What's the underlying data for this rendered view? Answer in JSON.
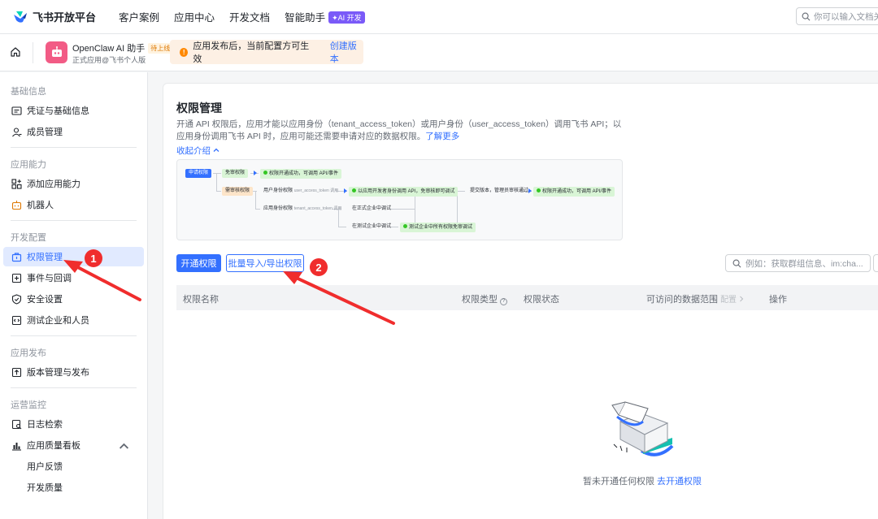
{
  "topnav": {
    "logo_text": "飞书开放平台",
    "links": [
      "客户案例",
      "应用中心",
      "开发文档",
      "智能助手"
    ],
    "ai_badge": "✦AI 开发",
    "search_placeholder": "你可以输入文档关"
  },
  "appbar": {
    "app_name": "OpenClaw AI 助手",
    "pending_badge": "待上线",
    "app_sub": "正式应用@飞书个人版",
    "notice_text": "应用发布后，当前配置方可生效",
    "notice_link": "创建版本"
  },
  "sidebar": {
    "sections": [
      {
        "title": "基础信息",
        "items": [
          "凭证与基础信息",
          "成员管理"
        ]
      },
      {
        "title": "应用能力",
        "items": [
          "添加应用能力",
          "机器人"
        ]
      },
      {
        "title": "开发配置",
        "items": [
          "权限管理",
          "事件与回调",
          "安全设置",
          "测试企业和人员"
        ]
      },
      {
        "title": "应用发布",
        "items": [
          "版本管理与发布"
        ]
      },
      {
        "title": "运营监控",
        "items": [
          "日志检索",
          "应用质量看板",
          "用户反馈",
          "开发质量"
        ]
      }
    ],
    "active_item": "权限管理"
  },
  "main": {
    "title": "权限管理",
    "description": "开通 API 权限后，应用才能以应用身份（tenant_access_token）或用户身份（user_access_token）调用飞书 API；以应用身份调用飞书 API 时，应用可能还需要申请对应的数据权限。",
    "learn_more": "了解更多",
    "collapse_link": "收起介绍",
    "flow": {
      "apply": "申请权限",
      "free_review": "免审权限",
      "enabled_call": "权限开通成功，可调用 API/事件",
      "need_review": "需审核权限",
      "user_perm": "用户身份权限",
      "user_token": "user_access_token 调用",
      "dev_identity": "以应用开发者身份调用 API，免审核即可调试",
      "submit_version": "提交版本，管理员审核通过",
      "app_perm": "应用身份权限",
      "tenant_token": "tenant_access_token 调用",
      "in_prod": "在正式企业中调试",
      "in_test": "在测试企业中调试",
      "test_enterprise": "测试企业中所有权限免审调试"
    },
    "buttons": {
      "enable": "开通权限",
      "batch": "批量导入/导出权限"
    },
    "search_placeholder": "例如：获取群组信息、im:cha...",
    "table_headers": {
      "name": "权限名称",
      "type": "权限类型",
      "status": "权限状态",
      "scope": "可访问的数据范围",
      "scope_config": "配置",
      "actions": "操作"
    },
    "empty_text": "暂未开通任何权限",
    "empty_link": "去开通权限"
  },
  "annotations": {
    "badge1": "1",
    "badge2": "2",
    "color": "#f02d2d"
  },
  "colors": {
    "accent": "#3370ff",
    "active_bg": "#e1eaff",
    "notice_bg": "#fdf0e4"
  }
}
